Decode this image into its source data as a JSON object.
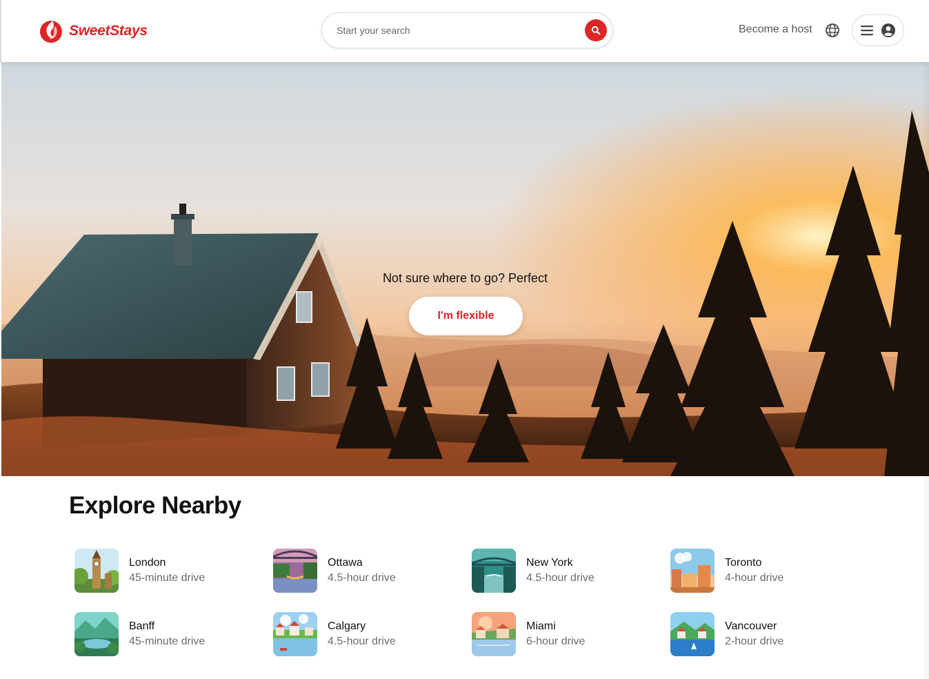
{
  "header": {
    "brand": "SweetStays",
    "search_placeholder": "Start your search",
    "host_label": "Become a host"
  },
  "hero": {
    "tagline": "Not sure where to go? Perfect",
    "cta_label": "I'm flexible"
  },
  "explore": {
    "title": "Explore Nearby",
    "items": [
      {
        "city": "London",
        "distance": "45-minute drive"
      },
      {
        "city": "Ottawa",
        "distance": "4.5-hour drive"
      },
      {
        "city": "New York",
        "distance": "4.5-hour drive"
      },
      {
        "city": "Toronto",
        "distance": "4-hour drive"
      },
      {
        "city": "Banff",
        "distance": "45-minute drive"
      },
      {
        "city": "Calgary",
        "distance": "4.5-hour drive"
      },
      {
        "city": "Miami",
        "distance": "6-hour drive"
      },
      {
        "city": "Vancouver",
        "distance": "2-hour drive"
      }
    ]
  },
  "colors": {
    "brand": "#dc2626",
    "text": "#111111",
    "muted": "#6b6b6b"
  },
  "icons": [
    "logo-flame-icon",
    "search-icon",
    "globe-icon",
    "menu-icon",
    "user-avatar-icon"
  ]
}
